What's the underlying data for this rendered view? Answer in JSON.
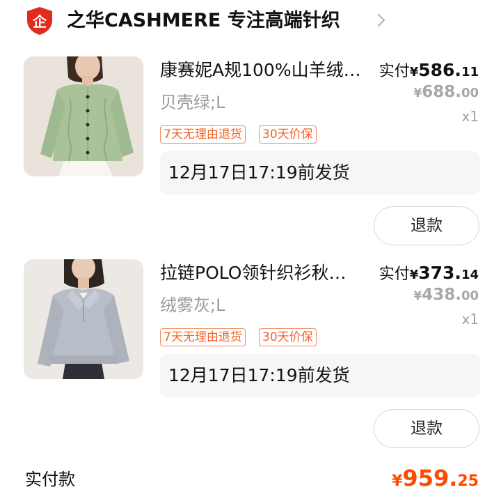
{
  "shop": {
    "name": "之华CASHMERE 专注高端针织",
    "logo_char": "企",
    "logo_icon": "shield-logo-icon",
    "chevron_icon": "chevron-right-icon",
    "brand_color": "#e02b20"
  },
  "items": [
    {
      "title": "康赛妮A规100%山羊绒…",
      "sku": "贝壳绿;L",
      "tags": [
        "7天无理由退货",
        "30天价保"
      ],
      "pay_label": "实付",
      "currency": "¥",
      "pay_int": "586.",
      "pay_dec": "11",
      "orig_int": "688.",
      "orig_dec": "00",
      "qty": "x1",
      "ship": "12月17日17:19前发货",
      "refund": "退款",
      "image": "green-cardigan-photo"
    },
    {
      "title": "拉链POLO领针织衫秋…",
      "sku": "绒雾灰;L",
      "tags": [
        "7天无理由退货",
        "30天价保"
      ],
      "pay_label": "实付",
      "currency": "¥",
      "pay_int": "373.",
      "pay_dec": "14",
      "orig_int": "438.",
      "orig_dec": "00",
      "qty": "x1",
      "ship": "12月17日17:19前发货",
      "refund": "退款",
      "image": "gray-polo-sweater-photo"
    }
  ],
  "total": {
    "label": "实付款",
    "currency": "¥",
    "int": "959.",
    "dec": "25",
    "color": "#ff4a00"
  }
}
